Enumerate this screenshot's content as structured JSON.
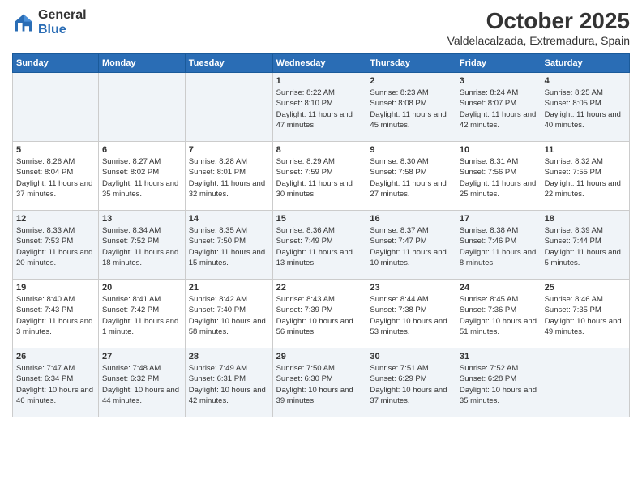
{
  "header": {
    "logo_general": "General",
    "logo_blue": "Blue",
    "title": "October 2025",
    "subtitle": "Valdelacalzada, Extremadura, Spain"
  },
  "days_of_week": [
    "Sunday",
    "Monday",
    "Tuesday",
    "Wednesday",
    "Thursday",
    "Friday",
    "Saturday"
  ],
  "weeks": [
    [
      {
        "day": "",
        "info": ""
      },
      {
        "day": "",
        "info": ""
      },
      {
        "day": "",
        "info": ""
      },
      {
        "day": "1",
        "info": "Sunrise: 8:22 AM\nSunset: 8:10 PM\nDaylight: 11 hours and 47 minutes."
      },
      {
        "day": "2",
        "info": "Sunrise: 8:23 AM\nSunset: 8:08 PM\nDaylight: 11 hours and 45 minutes."
      },
      {
        "day": "3",
        "info": "Sunrise: 8:24 AM\nSunset: 8:07 PM\nDaylight: 11 hours and 42 minutes."
      },
      {
        "day": "4",
        "info": "Sunrise: 8:25 AM\nSunset: 8:05 PM\nDaylight: 11 hours and 40 minutes."
      }
    ],
    [
      {
        "day": "5",
        "info": "Sunrise: 8:26 AM\nSunset: 8:04 PM\nDaylight: 11 hours and 37 minutes."
      },
      {
        "day": "6",
        "info": "Sunrise: 8:27 AM\nSunset: 8:02 PM\nDaylight: 11 hours and 35 minutes."
      },
      {
        "day": "7",
        "info": "Sunrise: 8:28 AM\nSunset: 8:01 PM\nDaylight: 11 hours and 32 minutes."
      },
      {
        "day": "8",
        "info": "Sunrise: 8:29 AM\nSunset: 7:59 PM\nDaylight: 11 hours and 30 minutes."
      },
      {
        "day": "9",
        "info": "Sunrise: 8:30 AM\nSunset: 7:58 PM\nDaylight: 11 hours and 27 minutes."
      },
      {
        "day": "10",
        "info": "Sunrise: 8:31 AM\nSunset: 7:56 PM\nDaylight: 11 hours and 25 minutes."
      },
      {
        "day": "11",
        "info": "Sunrise: 8:32 AM\nSunset: 7:55 PM\nDaylight: 11 hours and 22 minutes."
      }
    ],
    [
      {
        "day": "12",
        "info": "Sunrise: 8:33 AM\nSunset: 7:53 PM\nDaylight: 11 hours and 20 minutes."
      },
      {
        "day": "13",
        "info": "Sunrise: 8:34 AM\nSunset: 7:52 PM\nDaylight: 11 hours and 18 minutes."
      },
      {
        "day": "14",
        "info": "Sunrise: 8:35 AM\nSunset: 7:50 PM\nDaylight: 11 hours and 15 minutes."
      },
      {
        "day": "15",
        "info": "Sunrise: 8:36 AM\nSunset: 7:49 PM\nDaylight: 11 hours and 13 minutes."
      },
      {
        "day": "16",
        "info": "Sunrise: 8:37 AM\nSunset: 7:47 PM\nDaylight: 11 hours and 10 minutes."
      },
      {
        "day": "17",
        "info": "Sunrise: 8:38 AM\nSunset: 7:46 PM\nDaylight: 11 hours and 8 minutes."
      },
      {
        "day": "18",
        "info": "Sunrise: 8:39 AM\nSunset: 7:44 PM\nDaylight: 11 hours and 5 minutes."
      }
    ],
    [
      {
        "day": "19",
        "info": "Sunrise: 8:40 AM\nSunset: 7:43 PM\nDaylight: 11 hours and 3 minutes."
      },
      {
        "day": "20",
        "info": "Sunrise: 8:41 AM\nSunset: 7:42 PM\nDaylight: 11 hours and 1 minute."
      },
      {
        "day": "21",
        "info": "Sunrise: 8:42 AM\nSunset: 7:40 PM\nDaylight: 10 hours and 58 minutes."
      },
      {
        "day": "22",
        "info": "Sunrise: 8:43 AM\nSunset: 7:39 PM\nDaylight: 10 hours and 56 minutes."
      },
      {
        "day": "23",
        "info": "Sunrise: 8:44 AM\nSunset: 7:38 PM\nDaylight: 10 hours and 53 minutes."
      },
      {
        "day": "24",
        "info": "Sunrise: 8:45 AM\nSunset: 7:36 PM\nDaylight: 10 hours and 51 minutes."
      },
      {
        "day": "25",
        "info": "Sunrise: 8:46 AM\nSunset: 7:35 PM\nDaylight: 10 hours and 49 minutes."
      }
    ],
    [
      {
        "day": "26",
        "info": "Sunrise: 7:47 AM\nSunset: 6:34 PM\nDaylight: 10 hours and 46 minutes."
      },
      {
        "day": "27",
        "info": "Sunrise: 7:48 AM\nSunset: 6:32 PM\nDaylight: 10 hours and 44 minutes."
      },
      {
        "day": "28",
        "info": "Sunrise: 7:49 AM\nSunset: 6:31 PM\nDaylight: 10 hours and 42 minutes."
      },
      {
        "day": "29",
        "info": "Sunrise: 7:50 AM\nSunset: 6:30 PM\nDaylight: 10 hours and 39 minutes."
      },
      {
        "day": "30",
        "info": "Sunrise: 7:51 AM\nSunset: 6:29 PM\nDaylight: 10 hours and 37 minutes."
      },
      {
        "day": "31",
        "info": "Sunrise: 7:52 AM\nSunset: 6:28 PM\nDaylight: 10 hours and 35 minutes."
      },
      {
        "day": "",
        "info": ""
      }
    ]
  ]
}
